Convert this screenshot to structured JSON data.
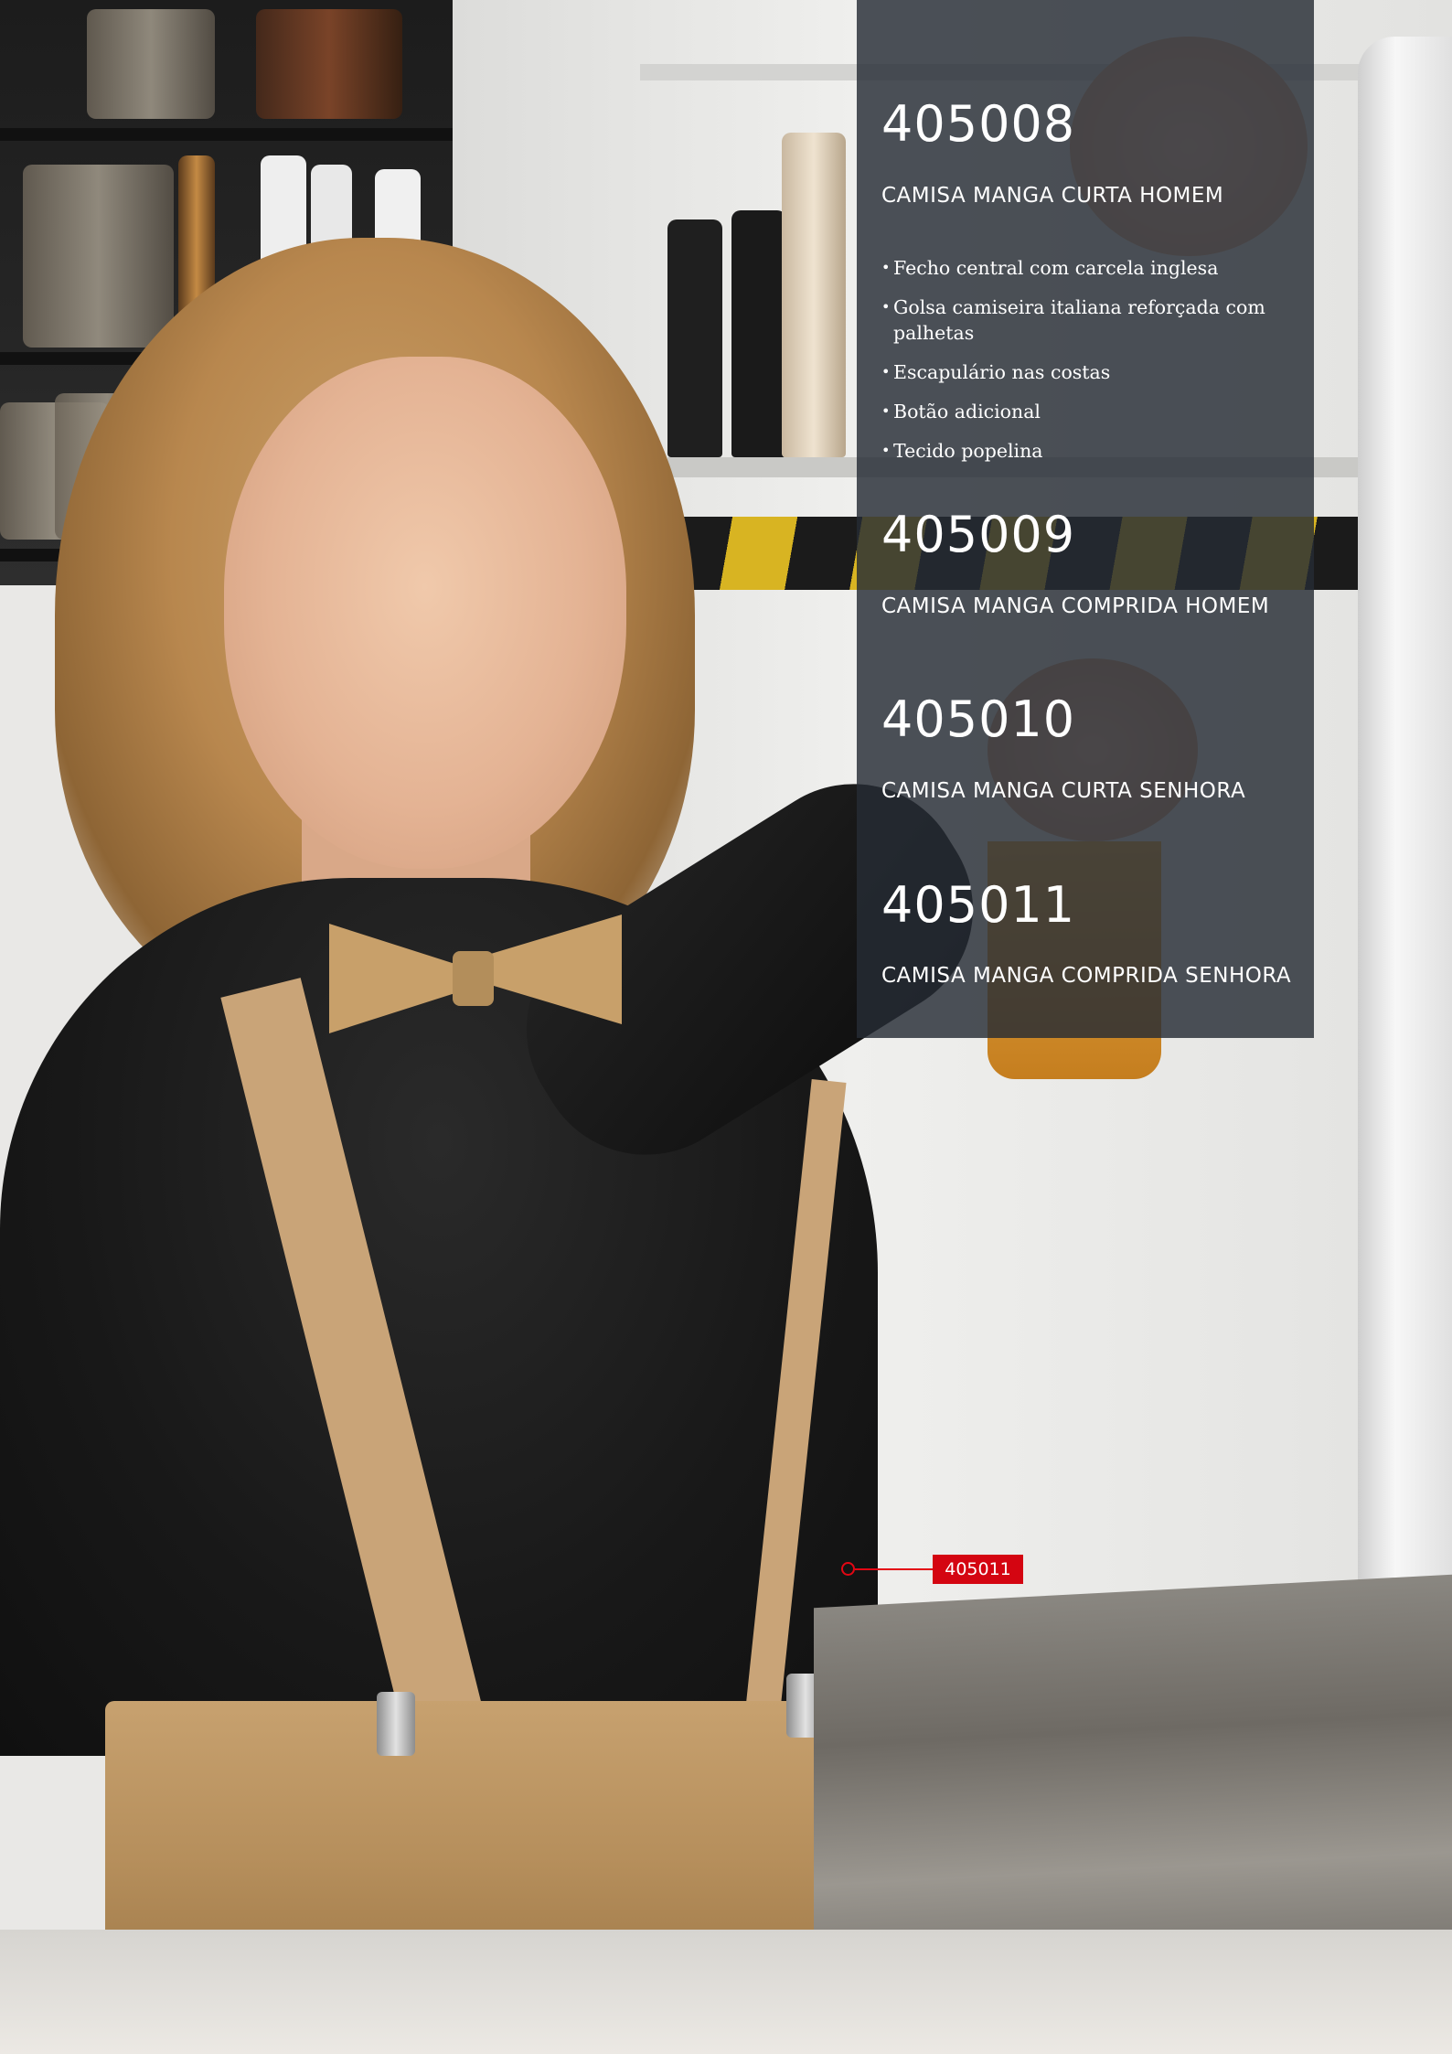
{
  "products": [
    {
      "code": "405008",
      "name": "CAMISA MANGA CURTA HOMEM",
      "features": [
        "Fecho central com carcela inglesa",
        "Golsa camiseira italiana reforçada com palhetas",
        "Escapulário nas costas",
        "Botão adicional",
        "Tecido popelina"
      ]
    },
    {
      "code": "405009",
      "name": "CAMISA MANGA COMPRIDA HOMEM"
    },
    {
      "code": "405010",
      "name": "CAMISA MANGA CURTA SENHORA"
    },
    {
      "code": "405011",
      "name": "CAMISA MANGA COMPRIDA SENHORA"
    }
  ],
  "callout": {
    "label": "405011",
    "color": "#d40511"
  },
  "colors": {
    "panel": "#262c34",
    "accent": "#d40511"
  }
}
